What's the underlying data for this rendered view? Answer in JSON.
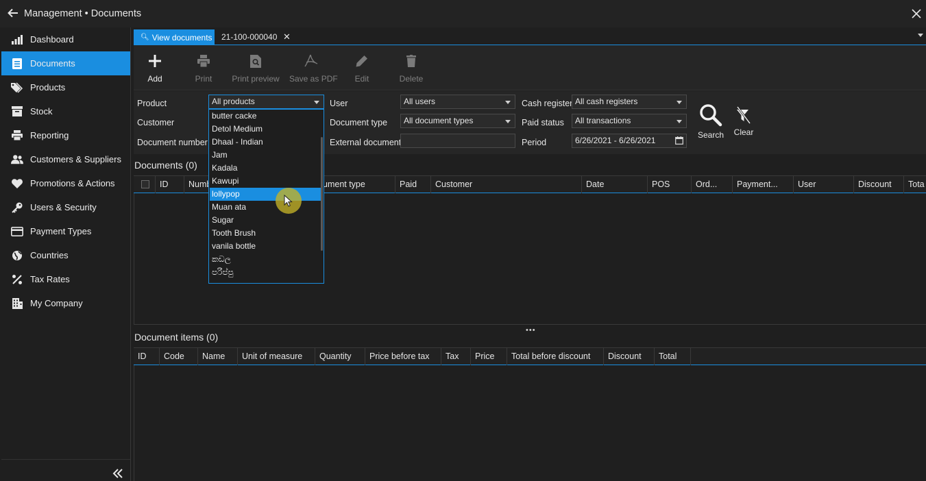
{
  "window": {
    "title": "Management • Documents"
  },
  "sidebar": {
    "items": [
      {
        "label": "Dashboard",
        "icon": "bar-chart-icon"
      },
      {
        "label": "Documents",
        "icon": "document-icon"
      },
      {
        "label": "Products",
        "icon": "tags-icon"
      },
      {
        "label": "Stock",
        "icon": "archive-icon"
      },
      {
        "label": "Reporting",
        "icon": "printer-icon"
      },
      {
        "label": "Customers & Suppliers",
        "icon": "users-icon"
      },
      {
        "label": "Promotions & Actions",
        "icon": "heart-icon"
      },
      {
        "label": "Users & Security",
        "icon": "key-icon"
      },
      {
        "label": "Payment Types",
        "icon": "credit-card-icon"
      },
      {
        "label": "Countries",
        "icon": "globe-icon"
      },
      {
        "label": "Tax Rates",
        "icon": "percent-icon"
      },
      {
        "label": "My Company",
        "icon": "building-icon"
      }
    ],
    "active_index": 1
  },
  "tabs": {
    "view_label": "View documents",
    "doc_label": "21-100-000040",
    "close_glyph": "✕"
  },
  "toolbar": {
    "add": "Add",
    "print": "Print",
    "print_preview": "Print preview",
    "save_pdf": "Save as PDF",
    "edit": "Edit",
    "delete": "Delete"
  },
  "filters": {
    "product_label": "Product",
    "product_value": "All products",
    "customer_label": "Customer",
    "document_number_label": "Document number",
    "user_label": "User",
    "user_value": "All users",
    "document_type_label": "Document type",
    "document_type_value": "All document types",
    "external_document_label": "External document",
    "external_document_value": "",
    "cash_register_label": "Cash register",
    "cash_register_value": "All cash registers",
    "paid_status_label": "Paid status",
    "paid_status_value": "All transactions",
    "period_label": "Period",
    "period_value": "6/26/2021 - 6/26/2021",
    "search_label": "Search",
    "clear_label": "Clear"
  },
  "product_dropdown": {
    "options": [
      "butter cacke",
      "Detol Medium",
      "Dhaal - Indian",
      "Jam",
      "Kadala",
      "Kawupi",
      "lollypop",
      "Muan ata",
      "Sugar",
      "Tooth Brush",
      "vanila bottle",
      "කඩල",
      "පරිප්පු"
    ],
    "selected": "lollypop"
  },
  "documents": {
    "title": "Documents (0)",
    "columns": [
      "ID",
      "Numb",
      "ument type",
      "Paid",
      "Customer",
      "Date",
      "POS",
      "Ord...",
      "Payment...",
      "User",
      "Discount",
      "Tota"
    ]
  },
  "document_items": {
    "title": "Document items (0)",
    "columns": [
      "ID",
      "Code",
      "Name",
      "Unit of measure",
      "Quantity",
      "Price before tax",
      "Tax",
      "Price",
      "Total before discount",
      "Discount",
      "Total"
    ]
  },
  "colors": {
    "accent": "#1a8ee0",
    "background": "#1f1f1f",
    "panel": "#262626",
    "cursor_halo": "#c4b228"
  }
}
